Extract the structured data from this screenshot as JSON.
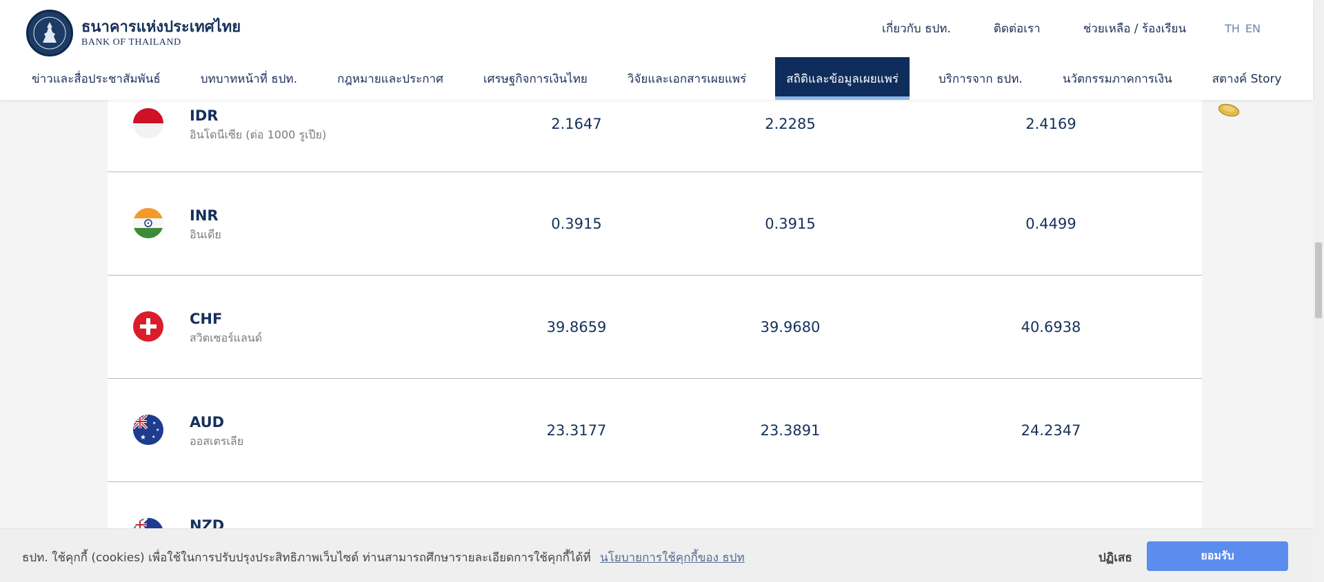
{
  "header": {
    "logo_th": "ธนาคารแห่งประเทศไทย",
    "logo_en": "BANK OF THAILAND",
    "top_links": [
      "เกี่ยวกับ ธปท.",
      "ติดต่อเรา",
      "ช่วยเหลือ / ร้องเรียน"
    ],
    "lang": [
      "TH",
      "EN"
    ]
  },
  "nav": {
    "items": [
      "ข่าวและสื่อประชาสัมพันธ์",
      "บทบาทหน้าที่ ธปท.",
      "กฎหมายและประกาศ",
      "เศรษฐกิจการเงินไทย",
      "วิจัยและเอกสารเผยแพร่",
      "สถิติและข้อมูลเผยแพร่",
      "บริการจาก ธปท.",
      "นวัตกรรมภาคการเงิน",
      "สตางค์ Story"
    ],
    "active_index": 5
  },
  "rates": [
    {
      "code": "IDR",
      "name": "อินโดนีเซีย (ต่อ 1000 รูเปีย)",
      "v1": "2.1647",
      "v2": "2.2285",
      "v3": "2.4169",
      "flag": "indonesia-flag-icon"
    },
    {
      "code": "INR",
      "name": "อินเดีย",
      "v1": "0.3915",
      "v2": "0.3915",
      "v3": "0.4499",
      "flag": "india-flag-icon"
    },
    {
      "code": "CHF",
      "name": "สวิตเซอร์แลนด์",
      "v1": "39.8659",
      "v2": "39.9680",
      "v3": "40.6938",
      "flag": "switzerland-flag-icon"
    },
    {
      "code": "AUD",
      "name": "ออสเตรเลีย",
      "v1": "23.3177",
      "v2": "23.3891",
      "v3": "24.2347",
      "flag": "australia-flag-icon"
    },
    {
      "code": "NZD",
      "name": "",
      "v1": "",
      "v2": "",
      "v3": "",
      "flag": "new-zealand-flag-icon"
    }
  ],
  "cookie": {
    "text": "ธปท. ใช้คุกกี้ (cookies) เพื่อใช้ในการปรับปรุงประสิทธิภาพเว็บไซต์ ท่านสามารถศึกษารายละเอียดการใช้คุกกี้ได้ที่",
    "link": "นโยบายการใช้คุกกี้ของ ธปท",
    "reject": "ปฏิเสธ",
    "accept": "ยอมรับ"
  },
  "colors": {
    "nav_active_bg": "#0f2d5c",
    "accent": "#5b8def",
    "text_primary": "#15305c"
  }
}
